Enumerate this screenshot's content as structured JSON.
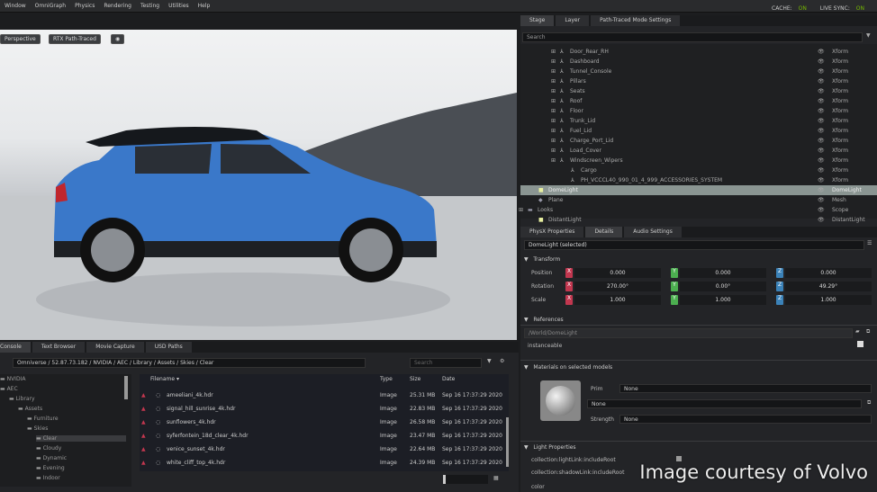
{
  "menubar": {
    "items": [
      "Window",
      "OmniGraph",
      "Physics",
      "Rendering",
      "Testing",
      "Utilities",
      "Help"
    ],
    "cache_label": "CACHE:",
    "cache_value": "ON",
    "livesync_label": "LIVE SYNC:",
    "livesync_value": "ON"
  },
  "viewport": {
    "camera_label": "Perspective",
    "render_mode": "RTX Path-Traced"
  },
  "stage": {
    "tabs": [
      "Stage",
      "Layer",
      "Path-Traced Mode Settings"
    ],
    "search_placeholder": "Search",
    "rows": [
      {
        "name": "Door_Rear_RH",
        "type": "Xform",
        "indent": 3,
        "icon": "xform"
      },
      {
        "name": "Dashboard",
        "type": "Xform",
        "indent": 3,
        "icon": "xform"
      },
      {
        "name": "Tunnel_Console",
        "type": "Xform",
        "indent": 3,
        "icon": "xform"
      },
      {
        "name": "Pillars",
        "type": "Xform",
        "indent": 3,
        "icon": "xform"
      },
      {
        "name": "Seats",
        "type": "Xform",
        "indent": 3,
        "icon": "xform"
      },
      {
        "name": "Roof",
        "type": "Xform",
        "indent": 3,
        "icon": "xform"
      },
      {
        "name": "Floor",
        "type": "Xform",
        "indent": 3,
        "icon": "xform"
      },
      {
        "name": "Trunk_Lid",
        "type": "Xform",
        "indent": 3,
        "icon": "xform"
      },
      {
        "name": "Fuel_Lid",
        "type": "Xform",
        "indent": 3,
        "icon": "xform"
      },
      {
        "name": "Charge_Port_Lid",
        "type": "Xform",
        "indent": 3,
        "icon": "xform"
      },
      {
        "name": "Load_Cover",
        "type": "Xform",
        "indent": 3,
        "icon": "xform"
      },
      {
        "name": "Windscreen_Wipers",
        "type": "Xform",
        "indent": 3,
        "icon": "xform"
      },
      {
        "name": "Cargo",
        "type": "Xform",
        "indent": 4,
        "icon": "xform"
      },
      {
        "name": "PH_VCCCL40_990_01_4_999_ACCESSORIES_SYSTEM",
        "type": "Xform",
        "indent": 4,
        "icon": "xform"
      },
      {
        "name": "DomeLight",
        "type": "DomeLight",
        "indent": 1,
        "icon": "light",
        "selected": true
      },
      {
        "name": "Plane",
        "type": "Mesh",
        "indent": 1,
        "icon": "mesh"
      },
      {
        "name": "Looks",
        "type": "Scope",
        "indent": 0,
        "icon": "folder"
      },
      {
        "name": "DistantLight",
        "type": "DistantLight",
        "indent": 1,
        "icon": "light"
      }
    ]
  },
  "properties": {
    "tabs": [
      "PhysX Properties",
      "Details",
      "Audio Settings"
    ],
    "selected": "DomeLight (selected)",
    "transform": {
      "title": "Transform",
      "rows": [
        {
          "label": "Position",
          "x": "0.000",
          "y": "0.000",
          "z": "0.000"
        },
        {
          "label": "Rotation",
          "x": "270.00°",
          "y": "0.00°",
          "z": "49.29°"
        },
        {
          "label": "Scale",
          "x": "1.000",
          "y": "1.000",
          "z": "1.000"
        }
      ]
    },
    "references": {
      "title": "References",
      "path": "/World/DomeLight",
      "instanceable_label": "instanceable"
    },
    "materials": {
      "title": "Materials on selected models",
      "prim_label": "Prim",
      "prim_value": "None",
      "material_value": "None",
      "strength_label": "Strength",
      "strength_value": "None"
    },
    "light": {
      "title": "Light Properties",
      "rows": [
        "collection:lightLink:includeRoot",
        "collection:shadowLink:includeRoot",
        "color"
      ]
    }
  },
  "content": {
    "tabs": [
      "Console",
      "Content",
      "Text Browser",
      "Movie Capture",
      "USD Paths"
    ],
    "path": "Omniverse / 52.87.73.182 / NVIDIA / AEC / Library / Assets / Skies / Clear",
    "search_placeholder": "Search",
    "tree": [
      {
        "name": "NVIDIA",
        "indent": 0
      },
      {
        "name": "AEC",
        "indent": 0
      },
      {
        "name": "Library",
        "indent": 1
      },
      {
        "name": "Assets",
        "indent": 2
      },
      {
        "name": "Furniture",
        "indent": 3
      },
      {
        "name": "Skies",
        "indent": 3
      },
      {
        "name": "Clear",
        "indent": 4,
        "selected": true
      },
      {
        "name": "Cloudy",
        "indent": 4
      },
      {
        "name": "Dynamic",
        "indent": 4
      },
      {
        "name": "Evening",
        "indent": 4
      },
      {
        "name": "Indoor",
        "indent": 4
      }
    ],
    "columns": [
      "Filename",
      "Type",
      "Size",
      "Date"
    ],
    "files": [
      {
        "name": "ameeliani_4k.hdr",
        "type": "Image",
        "size": "25.31 MB",
        "date": "Sep 16 17:37:29 2020"
      },
      {
        "name": "signal_hill_sunrise_4k.hdr",
        "type": "Image",
        "size": "22.83 MB",
        "date": "Sep 16 17:37:29 2020"
      },
      {
        "name": "sunflowers_4k.hdr",
        "type": "Image",
        "size": "26.58 MB",
        "date": "Sep 16 17:37:29 2020"
      },
      {
        "name": "syferfontein_18d_clear_4k.hdr",
        "type": "Image",
        "size": "23.47 MB",
        "date": "Sep 16 17:37:29 2020"
      },
      {
        "name": "venice_sunset_4k.hdr",
        "type": "Image",
        "size": "22.64 MB",
        "date": "Sep 16 17:37:29 2020"
      },
      {
        "name": "white_cliff_top_4k.hdr",
        "type": "Image",
        "size": "24.39 MB",
        "date": "Sep 16 17:37:29 2020"
      }
    ]
  },
  "watermark": "Image courtesy of Volvo",
  "colors": {
    "accent": "#76b900",
    "x_axis": "#c2374f",
    "y_axis": "#4caf50",
    "z_axis": "#3b82b8",
    "car_body": "#3a78c9"
  }
}
